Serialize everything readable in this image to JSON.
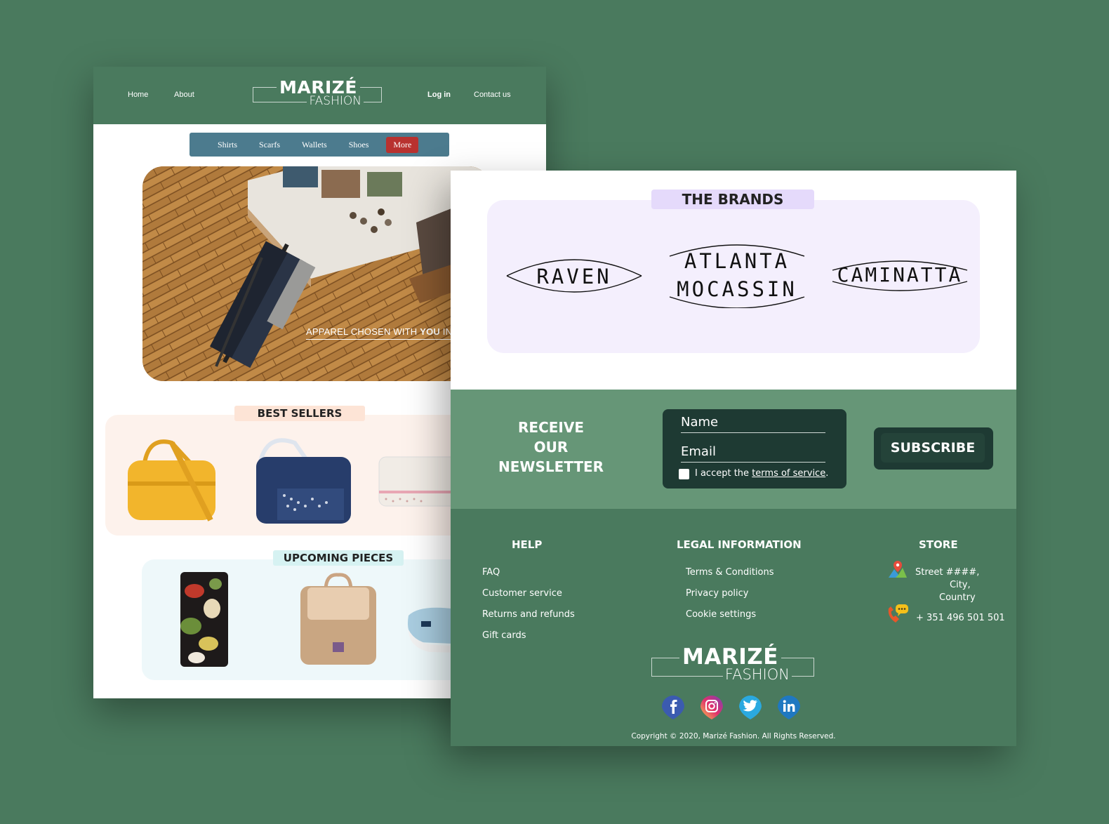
{
  "back_page": {
    "nav": {
      "home": "Home",
      "about": "About",
      "login": "Log in",
      "contact": "Contact us"
    },
    "logo": {
      "line1": "MARIZÉ",
      "line2": "FASHION"
    },
    "categories": [
      "Shirts",
      "Scarfs",
      "Wallets",
      "Shoes",
      "More"
    ],
    "hero": {
      "tagline_pre": "APPAREL CHOSEN WITH ",
      "tagline_bold": "YOU",
      "tagline_post": " IN"
    },
    "best_sellers": {
      "title": "BEST SELLERS"
    },
    "upcoming": {
      "title": "UPCOMING PIECES"
    }
  },
  "front_page": {
    "brands": {
      "title": "THE BRANDS",
      "items": [
        "RAVEN",
        "ATLANTA",
        "MOCASSIN",
        "CAMINATTA"
      ]
    },
    "newsletter": {
      "title_l1": "RECEIVE",
      "title_l2": "OUR",
      "title_l3": "NEWSLETTER",
      "name_placeholder": "Name",
      "email_placeholder": "Email",
      "accept_text": "I accept the ",
      "terms_link": "terms of service",
      "accept_end": ".",
      "subscribe": "SUBSCRIBE"
    },
    "footer": {
      "help": {
        "title": "HELP",
        "links": [
          "FAQ",
          "Customer service",
          "Returns and refunds",
          "Gift cards"
        ]
      },
      "legal": {
        "title": "LEGAL INFORMATION",
        "links": [
          "Terms & Conditions",
          "Privacy policy",
          "Cookie settings"
        ]
      },
      "store": {
        "title": "STORE",
        "address_l1": "Street ####,",
        "address_l2": "City,",
        "address_l3": "Country",
        "phone": "+ 351 496 501 501"
      },
      "logo": {
        "line1": "MARIZÉ",
        "line2": "FASHION"
      },
      "social": [
        "facebook-icon",
        "instagram-icon",
        "twitter-icon",
        "linkedin-icon"
      ],
      "copyright": "Copyright © 2020, Marizé Fashion. All Rights Reserved."
    }
  },
  "colors": {
    "background": "#4a7a5e",
    "header": "#4a7a5e",
    "category_bar": "#4c7b8e",
    "more_button": "#b8312f",
    "newsletter": "#669677",
    "form_dark": "#1e3a33",
    "brands_tab": "#e5dafb"
  }
}
